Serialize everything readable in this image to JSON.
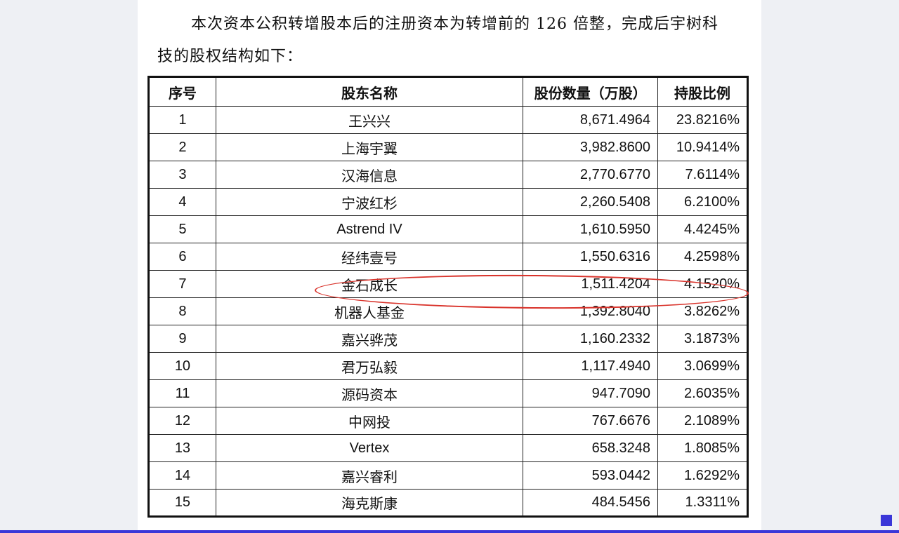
{
  "paragraph": {
    "line1": "本次资本公积转增股本后的注册资本为转增前的 126 倍整，完成后宇树科",
    "line2": "技的股权结构如下："
  },
  "table": {
    "headers": {
      "index": "序号",
      "name": "股东名称",
      "shares": "股份数量（万股）",
      "ratio": "持股比例"
    },
    "rows": [
      {
        "index": "1",
        "name": "王兴兴",
        "shares": "8,671.4964",
        "ratio": "23.8216%"
      },
      {
        "index": "2",
        "name": "上海宇翼",
        "shares": "3,982.8600",
        "ratio": "10.9414%"
      },
      {
        "index": "3",
        "name": "汉海信息",
        "shares": "2,770.6770",
        "ratio": "7.6114%"
      },
      {
        "index": "4",
        "name": "宁波红杉",
        "shares": "2,260.5408",
        "ratio": "6.2100%"
      },
      {
        "index": "5",
        "name": "Astrend IV",
        "shares": "1,610.5950",
        "ratio": "4.4245%"
      },
      {
        "index": "6",
        "name": "经纬壹号",
        "shares": "1,550.6316",
        "ratio": "4.2598%"
      },
      {
        "index": "7",
        "name": "金石成长",
        "shares": "1,511.4204",
        "ratio": "4.1520%"
      },
      {
        "index": "8",
        "name": "机器人基金",
        "shares": "1,392.8040",
        "ratio": "3.8262%"
      },
      {
        "index": "9",
        "name": "嘉兴骅茂",
        "shares": "1,160.2332",
        "ratio": "3.1873%"
      },
      {
        "index": "10",
        "name": "君万弘毅",
        "shares": "1,117.4940",
        "ratio": "3.0699%"
      },
      {
        "index": "11",
        "name": "源码资本",
        "shares": "947.7090",
        "ratio": "2.6035%"
      },
      {
        "index": "12",
        "name": "中网投",
        "shares": "767.6676",
        "ratio": "2.1089%"
      },
      {
        "index": "13",
        "name": "Vertex",
        "shares": "658.3248",
        "ratio": "1.8085%"
      },
      {
        "index": "14",
        "name": "嘉兴睿利",
        "shares": "593.0442",
        "ratio": "1.6292%"
      },
      {
        "index": "15",
        "name": "海克斯康",
        "shares": "484.5456",
        "ratio": "1.3311%"
      }
    ]
  },
  "colors": {
    "highlight": "#d9332b",
    "accent": "#3a37d8"
  }
}
